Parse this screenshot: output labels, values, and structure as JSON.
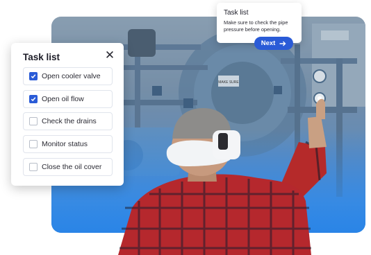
{
  "task_panel": {
    "title": "Task list",
    "close_icon": "close-icon",
    "items": [
      {
        "label": "Open cooler valve",
        "checked": true
      },
      {
        "label": "Open oil flow",
        "checked": true
      },
      {
        "label": "Check the drains",
        "checked": false
      },
      {
        "label": "Monitor status",
        "checked": false
      },
      {
        "label": "Close the oil cover",
        "checked": false
      }
    ]
  },
  "tooltip": {
    "title": "Task list",
    "text": "Make sure to check the pipe pressure before opening.",
    "next_label": "Next",
    "next_icon": "arrow-right-icon"
  },
  "scene_text": {
    "plate": "MAKE SURE"
  },
  "colors": {
    "accent": "#2a5bd7",
    "scene_blue": "#2f86e6"
  }
}
